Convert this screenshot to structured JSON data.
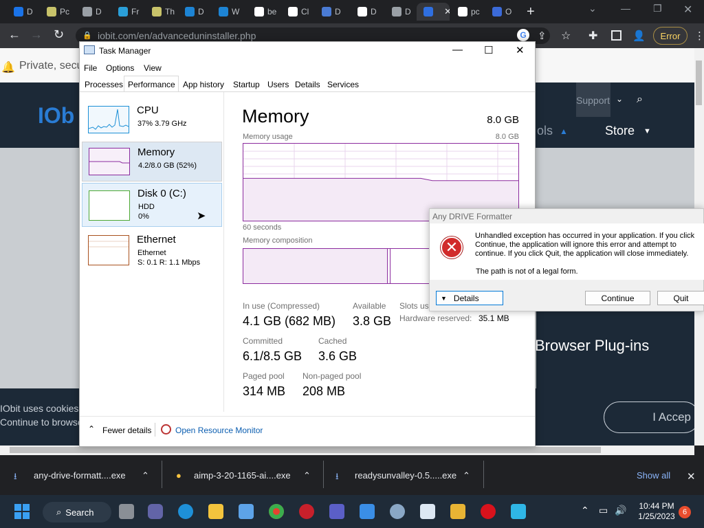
{
  "browser": {
    "tabs": [
      {
        "label": "D",
        "color": "#1a73e8"
      },
      {
        "label": "Pc",
        "color": "#c8c36a"
      },
      {
        "label": "D",
        "color": "#9aa0a6"
      },
      {
        "label": "Fr",
        "color": "#2a9fd8"
      },
      {
        "label": "Th",
        "color": "#c8c36a"
      },
      {
        "label": "D",
        "color": "#1d84d4"
      },
      {
        "label": "W",
        "color": "#1d84d4"
      },
      {
        "label": "be",
        "color": "#ffffff"
      },
      {
        "label": "Cl",
        "color": "#ffffff"
      },
      {
        "label": "D",
        "color": "#4a7bd4"
      },
      {
        "label": "D",
        "color": "#ffffff"
      },
      {
        "label": "D",
        "color": "#9aa0a6"
      },
      {
        "label": "",
        "color": "#2f6fe0"
      },
      {
        "label": "pc",
        "color": "#ffffff"
      },
      {
        "label": "O",
        "color": "#3b6ad8"
      }
    ],
    "url": "iobit.com/en/advanceduninstaller.php",
    "error_label": "Error"
  },
  "webpage": {
    "notification": "Private, secu",
    "logo": "IOb",
    "support": "Support",
    "store": "Store",
    "nav_partial": "ols",
    "plugins": "Browser Plug-ins",
    "cookie_line1": "IObit uses cookies",
    "cookie_line2": "Continue to browse",
    "accept": "I Accep"
  },
  "taskmanager": {
    "title": "Task Manager",
    "menu": [
      "File",
      "Options",
      "View"
    ],
    "tabs": [
      "Processes",
      "Performance",
      "App history",
      "Startup",
      "Users",
      "Details",
      "Services"
    ],
    "sidebar": [
      {
        "name": "CPU",
        "sub1": "37% 3.79 GHz",
        "sub2": "",
        "sub3": "",
        "color": "#1a8fd6"
      },
      {
        "name": "Memory",
        "sub1": "4.2/8.0 GB (52%)",
        "sub2": "",
        "sub3": "",
        "color": "#8b2b9e"
      },
      {
        "name": "Disk 0 (C:)",
        "sub1": "HDD",
        "sub2": "0%",
        "sub3": "",
        "color": "#4da832"
      },
      {
        "name": "Ethernet",
        "sub1": "Ethernet",
        "sub2": "S: 0.1  R: 1.1 Mbps",
        "sub3": "",
        "color": "#a8501d"
      }
    ],
    "memory": {
      "heading": "Memory",
      "total": "8.0 GB",
      "usage_label": "Memory usage",
      "usage_max": "8.0 GB",
      "seconds": "60 seconds",
      "composition_label": "Memory composition",
      "stats": [
        {
          "label": "In use (Compressed)",
          "value": "4.1 GB (682 MB)"
        },
        {
          "label": "Available",
          "value": "3.8 GB"
        },
        {
          "label": "Committed",
          "value": "6.1/8.5 GB"
        },
        {
          "label": "Cached",
          "value": "3.6 GB"
        },
        {
          "label": "Paged pool",
          "value": "314 MB"
        },
        {
          "label": "Non-paged pool",
          "value": "208 MB"
        }
      ],
      "slots_label": "Slots use",
      "hw_reserved_label": "Hardware reserved:",
      "hw_reserved_value": "35.1 MB",
      "usage_fraction": 0.52
    },
    "fewer_details": "Fewer details",
    "open_resource_monitor": "Open Resource Monitor"
  },
  "dialog": {
    "title": "Any DRIVE Formatter",
    "message": "Unhandled exception has occurred in your application. If you click Continue, the application will ignore this error and attempt to continue. If you click Quit, the application will close immediately.",
    "path_message": "The path is not of a legal form.",
    "details": "Details",
    "continue": "Continue",
    "quit": "Quit"
  },
  "downloads": {
    "items": [
      "any-drive-formatt....exe",
      "aimp-3-20-1165-ai....exe",
      "readysunvalley-0.5.....exe"
    ],
    "show_all": "Show all"
  },
  "taskbar": {
    "search": "Search",
    "time": "10:44 PM",
    "date": "1/25/2023",
    "badge": "6"
  }
}
